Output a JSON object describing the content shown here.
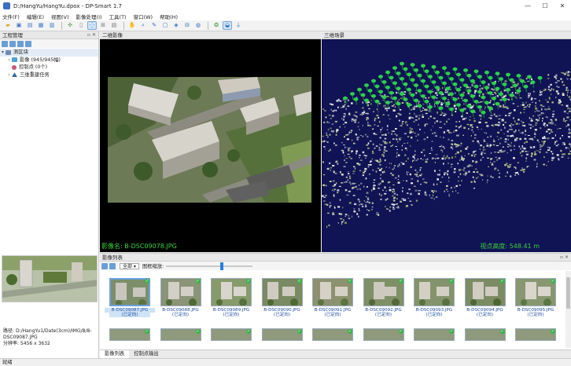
{
  "window": {
    "title": "D:/HangYu/HangYu.dpox - DP-Smart 1.7",
    "ctrl_min": "—",
    "ctrl_max": "☐",
    "ctrl_close": "✕"
  },
  "menu": [
    "文件(F)",
    "编辑(E)",
    "视图(V)",
    "影像处理(I)",
    "工具(T)",
    "窗口(W)",
    "帮助(H)"
  ],
  "left_panel": {
    "title": "工程管理",
    "tree": [
      {
        "label": "测区块",
        "icon": "block-icon"
      },
      {
        "label": "影像 (945/945幅)",
        "icon": "image-icon"
      },
      {
        "label": "控制点 (0个)",
        "icon": "control-point-icon"
      },
      {
        "label": "三维重建任务",
        "icon": "reconstruction-icon"
      }
    ],
    "path_label": "路径:",
    "path_value": "D:/HangYu1/Date(3cm)/IMG/8/8-DSC09087.JPG",
    "resolution": "分辨率: 5456 x 3632"
  },
  "view2d": {
    "title": "二维影像",
    "status": "影像名: B-DSC09078.JPG"
  },
  "view3d": {
    "title": "三维场景",
    "status": "视点高度: 548.41 m"
  },
  "image_list": {
    "title": "影像列表",
    "filter_value": "全部",
    "zoom_label": "图框缩放:",
    "zoom_level": 0.65,
    "thumbnails": [
      {
        "name": "B-DSC09087.JPG",
        "state": "(已定向)"
      },
      {
        "name": "B-DSC09088.JPG",
        "state": "(已定向)"
      },
      {
        "name": "B-DSC09089.JPG",
        "state": "(已定向)"
      },
      {
        "name": "B-DSC09090.JPG",
        "state": "(已定向)"
      },
      {
        "name": "B-DSC09091.JPG",
        "state": "(已定向)"
      },
      {
        "name": "B-DSC09092.JPG",
        "state": "(已定向)"
      },
      {
        "name": "B-DSC09093.JPG",
        "state": "(已定向)"
      },
      {
        "name": "B-DSC09094.JPG",
        "state": "(已定向)"
      },
      {
        "name": "B-DSC09095.JPG",
        "state": "(已定向)"
      }
    ],
    "tabs": [
      "影像列表",
      "控制点输出"
    ]
  },
  "statusbar": {
    "text": "就绪"
  },
  "colors": {
    "accent": "#2a7de1",
    "status_green": "#3bd33b",
    "scene_bg": "#101354",
    "camera_green": "#2bd14b"
  }
}
